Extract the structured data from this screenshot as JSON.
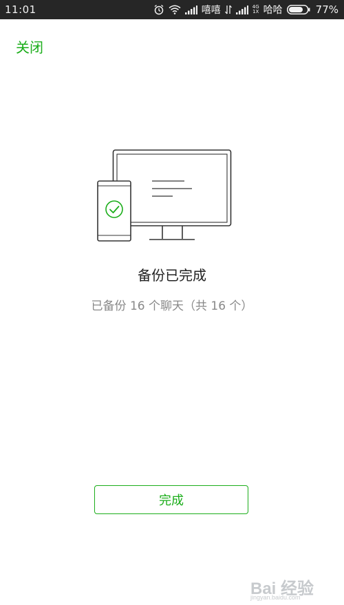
{
  "status_bar": {
    "time": "11:01",
    "carrier1": "嘻嘻",
    "carrier2": "哈哈",
    "net_top": "4G",
    "net_bottom": "1X",
    "battery": "77%"
  },
  "nav": {
    "close_label": "关闭"
  },
  "content": {
    "title": "备份已完成",
    "subtitle": "已备份 16 个聊天（共 16 个）"
  },
  "actions": {
    "done_label": "完成"
  },
  "watermark": {
    "logo": "Bai 经验",
    "url": "jingyan.baidu.com"
  },
  "colors": {
    "accent": "#1aad19",
    "status_bar": "#262626",
    "title": "#222222",
    "subtitle": "#888888",
    "illustration_stroke": "#333333"
  }
}
